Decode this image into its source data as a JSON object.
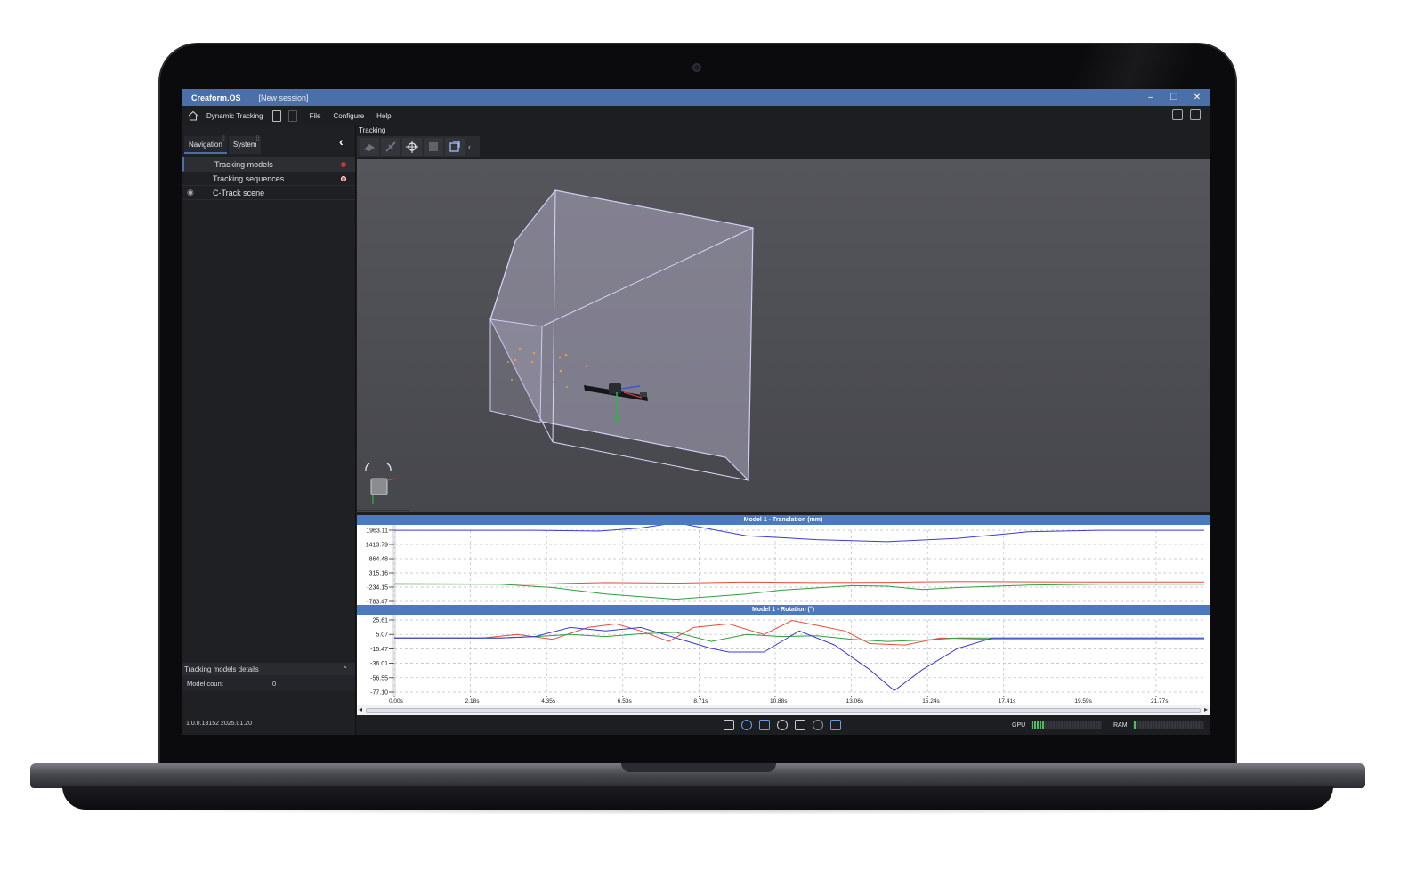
{
  "window": {
    "app_name": "Creaform.OS",
    "session": "[New session]",
    "minimize": "–",
    "restore": "❐",
    "close": "✕"
  },
  "menubar": {
    "mode": "Dynamic Tracking",
    "menus": [
      "File",
      "Configure",
      "Help"
    ]
  },
  "left_panel": {
    "tabs": [
      "Navigation",
      "System"
    ],
    "tree": [
      {
        "label": "Tracking models",
        "selected": true,
        "status_color": "#c0392b"
      },
      {
        "label": "Tracking sequences",
        "selected": false,
        "status_color": "#e74c3c"
      },
      {
        "label": "C-Track scene",
        "selected": false,
        "visible": true
      }
    ],
    "details": {
      "title": "Tracking models details",
      "rows": [
        {
          "key": "Model count",
          "value": "0"
        }
      ]
    },
    "version": "1.0.0.13152 2025.01.20"
  },
  "toolbar": {
    "title": "Tracking",
    "tools": [
      "surface-icon",
      "probe-icon",
      "target-crosshair-icon",
      "model-icon",
      "sequence-icon"
    ]
  },
  "colors": {
    "titlebar": "#4b6fa8",
    "chart_header": "#4b7ac0",
    "series_x": "#e74c3c",
    "series_y": "#2e9e3f",
    "series_z": "#3b3bd9",
    "gpu_meter": "#49c05b"
  },
  "chart_data": [
    {
      "type": "line",
      "title": "Model 1 - Translation (mm)",
      "y_ticks": [
        "1963.11",
        "1413.79",
        "864.48",
        "315.16",
        "-234.15",
        "-783.47"
      ],
      "ylim": [
        -783.47,
        1963.11
      ],
      "x_ticks": [
        "0.00s",
        "2.18s",
        "4.35s",
        "6.53s",
        "8.71s",
        "10.88s",
        "13.06s",
        "15.24s",
        "17.41s",
        "19.59s",
        "21.77s"
      ],
      "xlim": [
        0,
        23.0
      ],
      "grid": true,
      "series": [
        {
          "color": "#3b3bd9",
          "x": [
            0,
            4,
            5.8,
            7,
            8,
            10,
            12,
            14,
            16,
            18,
            20,
            22,
            23
          ],
          "values": [
            1960,
            1960,
            1930,
            2050,
            2250,
            1750,
            1600,
            1520,
            1650,
            1900,
            1960,
            1960,
            1960
          ]
        },
        {
          "color": "#e74c3c",
          "x": [
            0,
            4,
            6,
            8,
            10,
            12,
            14,
            16,
            18,
            20,
            23
          ],
          "values": [
            -100,
            -120,
            -60,
            -80,
            -40,
            -60,
            -50,
            -20,
            -30,
            -40,
            -40
          ]
        },
        {
          "color": "#2e9e3f",
          "x": [
            0,
            3,
            4.5,
            6,
            8,
            10,
            11,
            13,
            14,
            15,
            16,
            18,
            20,
            23
          ],
          "values": [
            -120,
            -120,
            -250,
            -500,
            -700,
            -500,
            -350,
            -180,
            -200,
            -330,
            -250,
            -160,
            -120,
            -120
          ]
        }
      ]
    },
    {
      "type": "line",
      "title": "Model 1 - Rotation (°)",
      "y_ticks": [
        "25.61",
        "5.07",
        "-15.47",
        "-36.01",
        "-56.55",
        "-77.10"
      ],
      "ylim": [
        -77.1,
        25.61
      ],
      "x_ticks": [
        "0.00s",
        "2.18s",
        "4.35s",
        "6.53s",
        "8.71s",
        "10.88s",
        "13.06s",
        "15.24s",
        "17.41s",
        "19.59s",
        "21.77s"
      ],
      "xlim": [
        0,
        23.0
      ],
      "grid": true,
      "series": [
        {
          "color": "#e74c3c",
          "x": [
            0,
            2.5,
            3.5,
            4.5,
            5.5,
            6.3,
            7,
            7.8,
            8.5,
            9.5,
            10.5,
            11.3,
            12,
            12.8,
            13.5,
            14.5,
            15.5,
            17,
            23
          ],
          "values": [
            0,
            0,
            5,
            -2,
            15,
            20,
            10,
            -5,
            15,
            20,
            5,
            25,
            18,
            10,
            -8,
            -10,
            0,
            -2,
            -2
          ]
        },
        {
          "color": "#2e9e3f",
          "x": [
            0,
            3,
            4,
            5,
            6,
            7,
            8,
            9,
            10,
            11,
            12,
            13,
            14,
            15,
            16,
            23
          ],
          "values": [
            0,
            0,
            2,
            5,
            2,
            6,
            8,
            -5,
            5,
            2,
            3,
            -2,
            -5,
            -3,
            0,
            0
          ]
        },
        {
          "color": "#3b3bd9",
          "x": [
            0,
            3,
            4,
            5,
            6,
            7,
            8,
            9,
            9.5,
            10.5,
            11.5,
            12.5,
            13.5,
            14.2,
            15,
            16,
            17,
            23
          ],
          "values": [
            0,
            0,
            2,
            15,
            10,
            15,
            0,
            -15,
            -20,
            -20,
            10,
            -10,
            -45,
            -75,
            -45,
            -15,
            0,
            0
          ]
        }
      ]
    }
  ],
  "status": {
    "icons": [
      "scan-icon",
      "hand-icon",
      "network-icon",
      "antenna-icon",
      "warning-icon",
      "cube-icon",
      "layers-icon"
    ],
    "gpu_label": "GPU",
    "gpu_level": 0.2,
    "ram_label": "RAM",
    "ram_level": 0.02
  }
}
